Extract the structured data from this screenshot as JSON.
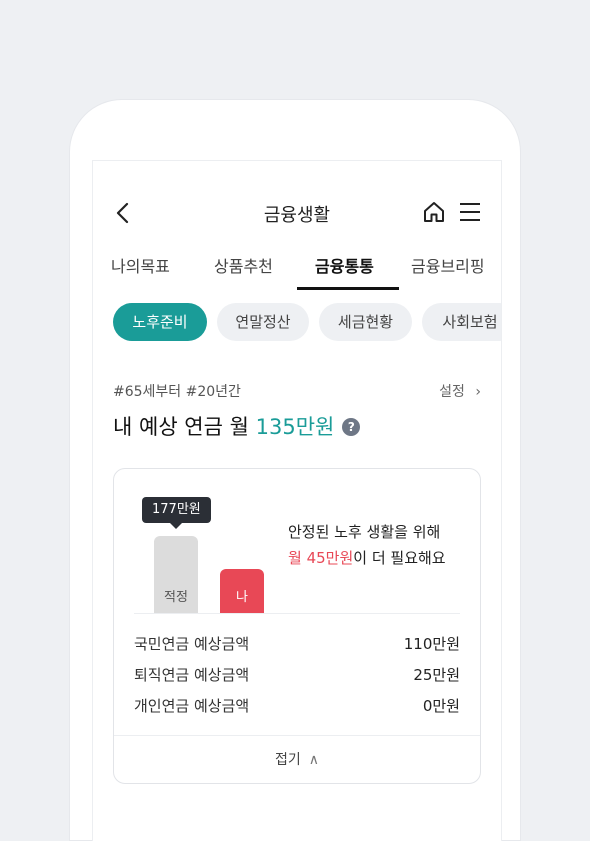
{
  "header": {
    "title": "금융생활"
  },
  "tabs": [
    {
      "label": "나의목표"
    },
    {
      "label": "상품추천"
    },
    {
      "label": "금융통통"
    },
    {
      "label": "금융브리핑"
    }
  ],
  "active_tab": "금융통통",
  "chips": [
    {
      "label": "노후준비"
    },
    {
      "label": "연말정산"
    },
    {
      "label": "세금현황"
    },
    {
      "label": "사회보험"
    }
  ],
  "active_chip": "노후준비",
  "pension": {
    "meta": "#65세부터 #20년간",
    "settings": "설정",
    "headline_prefix": "내 예상 연금 월 ",
    "headline_amount": "135만원",
    "help": "?"
  },
  "panel": {
    "tooltip": "177만원",
    "bar_target_label": "적정",
    "bar_mine_label": "나",
    "message_line1": "안정된 노후 생활을 위해",
    "message_need": "월 45만원",
    "message_tail": "이 더 필요해요",
    "rows": [
      {
        "label": "국민연금 예상금액",
        "value": "110만원"
      },
      {
        "label": "퇴직연금 예상금액",
        "value": "25만원"
      },
      {
        "label": "개인연금 예상금액",
        "value": "0만원"
      }
    ],
    "collapse": "접기"
  },
  "colors": {
    "accent": "#1a9c98",
    "need": "#e84856",
    "bar_target": "#dcdcdc"
  },
  "icons": [
    "back-arrow-icon",
    "home-icon",
    "hamburger-menu-icon",
    "help-icon",
    "chevron-right-icon",
    "chevron-up-icon"
  ]
}
